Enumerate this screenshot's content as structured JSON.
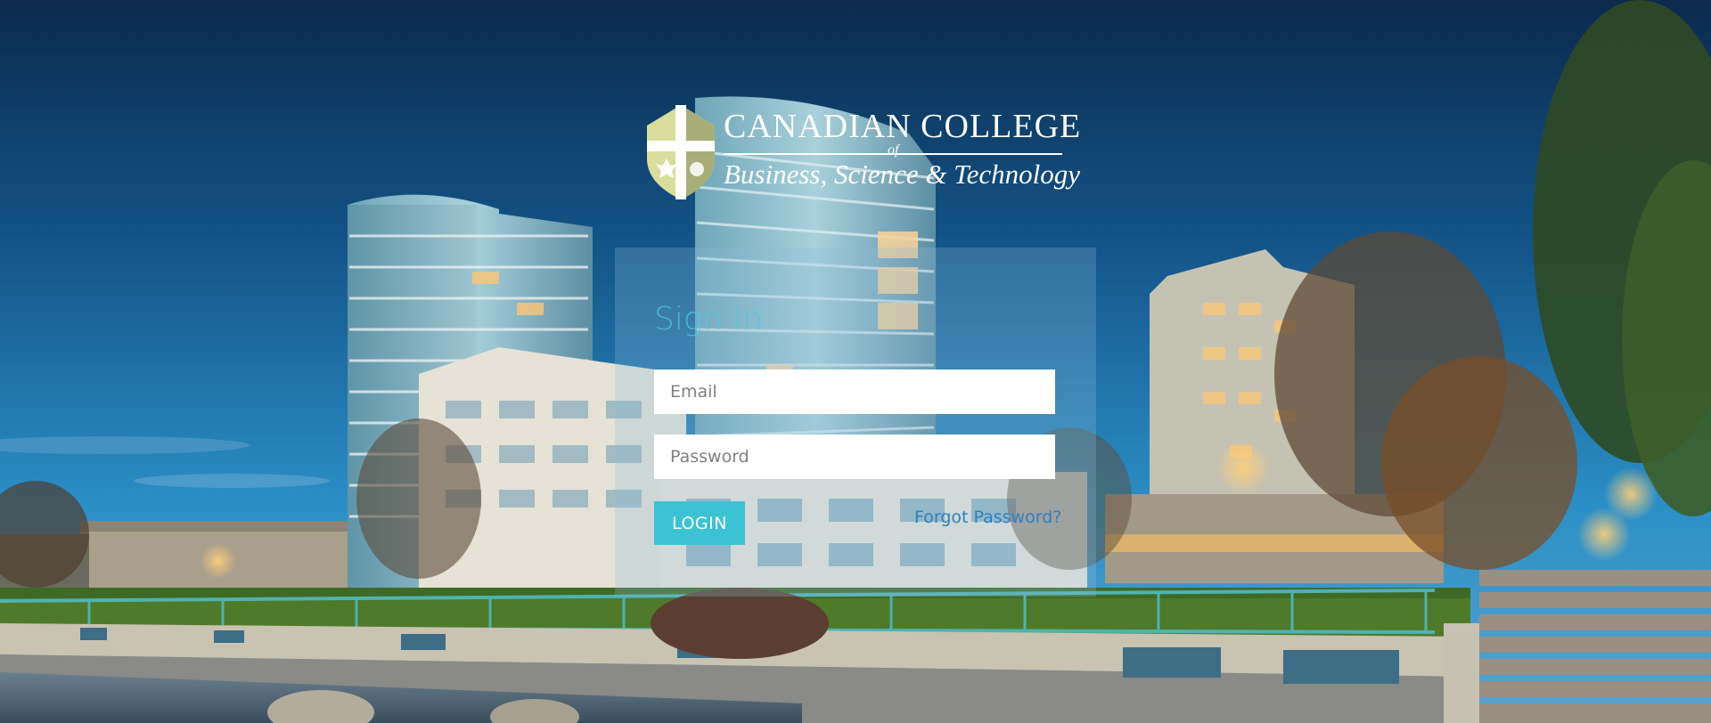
{
  "logo": {
    "line1": "CANADIAN COLLEGE",
    "of": "of",
    "line2": "Business, Science & Technology",
    "colors": {
      "shield_left": "#d9dd9b",
      "shield_right": "#a9ae79",
      "cross": "#ffffff"
    }
  },
  "login": {
    "title": "Sign In",
    "email_placeholder": "Email",
    "password_placeholder": "Password",
    "login_label": "LOGIN",
    "forgot_label": "Forgot Password?"
  },
  "theme": {
    "accent": "#3cc3d3",
    "link": "#2e7fc0",
    "sky_top": "#0b2a4d",
    "sky_bottom": "#2b8fc6"
  },
  "icons": {
    "logo": "college-shield-icon"
  }
}
